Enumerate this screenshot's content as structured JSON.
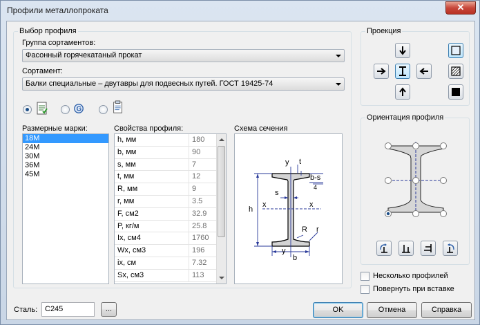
{
  "window": {
    "title": "Профили металлопроката",
    "close_glyph": "✕"
  },
  "selection": {
    "group_title": "Выбор профиля",
    "assortment_group_label": "Группа сортаментов:",
    "assortment_group_value": "Фасонный горячекатаный прокат",
    "assortment_label": "Сортамент:",
    "assortment_value": "Балки специальные – двутавры для подвесных путей. ГОСТ 19425-74",
    "radio_options": [
      {
        "icon": "document-icon",
        "selected": true
      },
      {
        "icon": "web-icon",
        "selected": false
      },
      {
        "icon": "clipboard-icon",
        "selected": false
      }
    ],
    "sizes_label": "Размерные марки:",
    "sizes": [
      "18М",
      "24М",
      "30М",
      "36М",
      "45М"
    ],
    "selected_size": "18М",
    "props_label": "Свойства профиля:",
    "props": [
      {
        "name": "h, мм",
        "value": "180"
      },
      {
        "name": "b, мм",
        "value": "90"
      },
      {
        "name": "s, мм",
        "value": "7"
      },
      {
        "name": "t, мм",
        "value": "12"
      },
      {
        "name": "R, мм",
        "value": "9"
      },
      {
        "name": "r, мм",
        "value": "3.5"
      },
      {
        "name": "F, см2",
        "value": "32.9"
      },
      {
        "name": "P, кг/м",
        "value": "25.8"
      },
      {
        "name": "Ix, см4",
        "value": "1760"
      },
      {
        "name": "Wx, см3",
        "value": "196"
      },
      {
        "name": "ix, см",
        "value": "7.32"
      },
      {
        "name": "Sx, см3",
        "value": "113"
      }
    ],
    "scheme_label": "Схема сечения",
    "scheme_text": {
      "y": "y",
      "t": "t",
      "bs": "b-s",
      "four": "4",
      "s": "s",
      "h": "h",
      "x": "x",
      "R": "R",
      "r": "r",
      "b": "b"
    }
  },
  "projection": {
    "title": "Проекция"
  },
  "orientation": {
    "title": "Ориентация профиля"
  },
  "options": {
    "multiple_profiles": "Несколько профилей",
    "rotate_on_insert": "Повернуть при вставке"
  },
  "steel": {
    "label": "Сталь:",
    "value": "С245",
    "browse": "..."
  },
  "buttons": {
    "ok": "OK",
    "cancel": "Отмена",
    "help": "Справка"
  }
}
